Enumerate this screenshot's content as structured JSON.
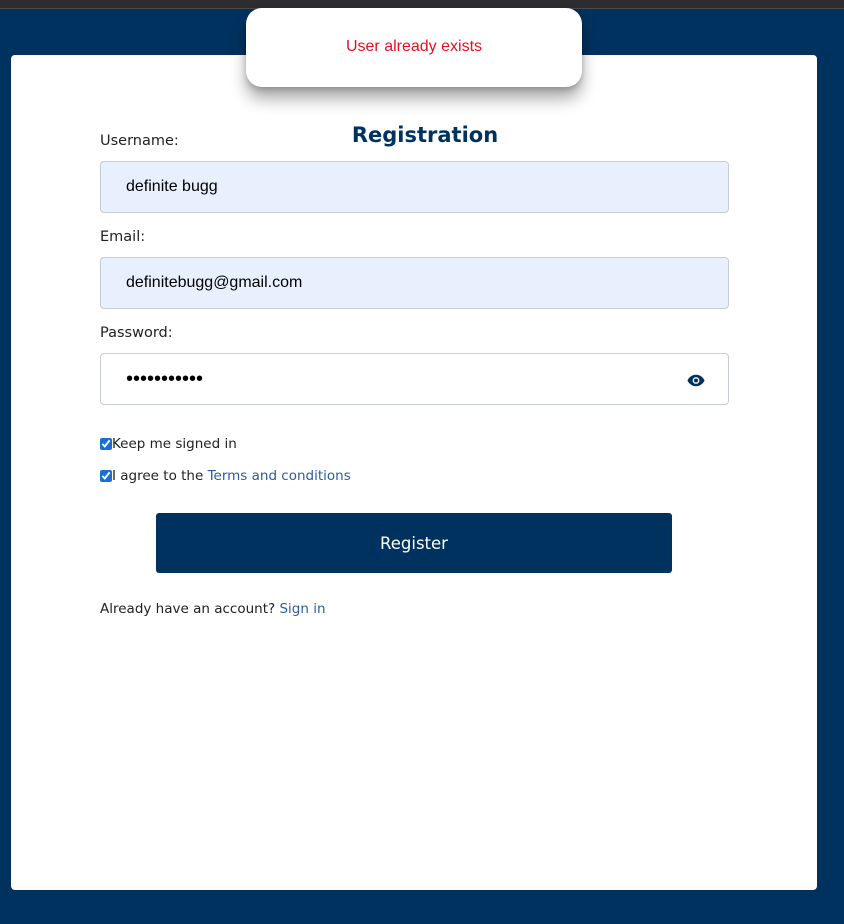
{
  "toast": {
    "message": "User already exists",
    "message_color": "#e8101c"
  },
  "form": {
    "title": "Registration",
    "username": {
      "label": "Username:",
      "value": "definite bugg"
    },
    "email": {
      "label": "Email:",
      "value": "definitebugg@gmail.com"
    },
    "password": {
      "label": "Password:",
      "masked_value": "•••••••••••",
      "toggle_icon": "eye-icon"
    },
    "keep_signed_in": {
      "label": "Keep me signed in",
      "checked": true
    },
    "terms": {
      "prefix": "I agree to the ",
      "link_text": "Terms and conditions",
      "checked": true
    },
    "submit_label": "Register",
    "signin": {
      "prefix": "Already have an account? ",
      "link_text": "Sign in"
    }
  },
  "colors": {
    "brand": "#00325f",
    "link": "#2b5d9b",
    "autofill_bg": "#e8f0fe"
  }
}
